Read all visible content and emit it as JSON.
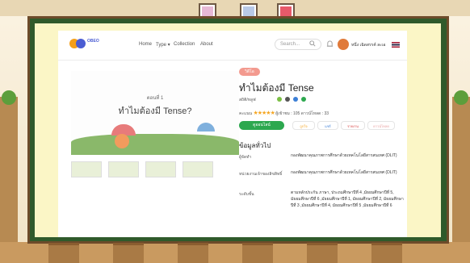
{
  "page": {
    "colors": {
      "board": "#2f5a2b",
      "paper": "#fbf6c6",
      "accent": "#2da84f",
      "brand_orange": "#f59f1a",
      "brand_blue": "#4b5dd3"
    }
  },
  "navbar": {
    "logo_text": "OBEO",
    "logo_sub": "",
    "links": [
      "Home",
      "Type ▾",
      "Collection",
      "About"
    ],
    "search_placeholder": "Search...",
    "search_icon": "search-icon",
    "user_name": "หนึ่ง เฉิดสรรค์ ละเอ"
  },
  "video": {
    "episode": "ตอนที่ 1",
    "title": "ทำไมต้องมี Tense?",
    "thumbnails": 4
  },
  "detail": {
    "badge": "วิดีโอ",
    "title": "ทำไมต้องมี Tense",
    "subject": "สถิติ/หลูฟ",
    "rating_label": "คะแนน",
    "stars": "★★★★★",
    "views": "ผู้เข้าชม : 105",
    "downloads": "ดาวน์โหลด : 33",
    "main_button": "ดูออนไลน์",
    "actions": [
      "ถูกใจ",
      "แชร์",
      "รายงาน",
      "ดาวน์โหลด"
    ],
    "section_title": "ข้อมูลทั่วไป",
    "rows": [
      {
        "label": "ผู้จัดทำ",
        "value": "กองพัฒนาคุณภาพการศึกษาด้วยเทคโนโลยีสารสนเทศ (DLIT)"
      },
      {
        "label": "หน่วยงานเจ้าของลิขสิทธิ์",
        "value": "กองพัฒนาคุณภาพการศึกษาด้วยเทคโนโลยีสารสนเทศ (DLIT)"
      },
      {
        "label": "ระดับชั้น",
        "value": "ตามหลักประกัน ภาษา, ประถมศึกษาปีที่ 4 ,มัธยมศึกษาปีที่ 5, มัธยมศึกษาปีที่ 6 ,มัธยมศึกษาปีที่ 1, มัธยมศึกษาปีที่ 2, มัธยมศึกษาปีที่ 3 ,มัธยมศึกษาปีที่ 4, มัธยมศึกษาปีที่ 5 ,มัธยมศึกษาปีที่ 6"
      }
    ]
  }
}
